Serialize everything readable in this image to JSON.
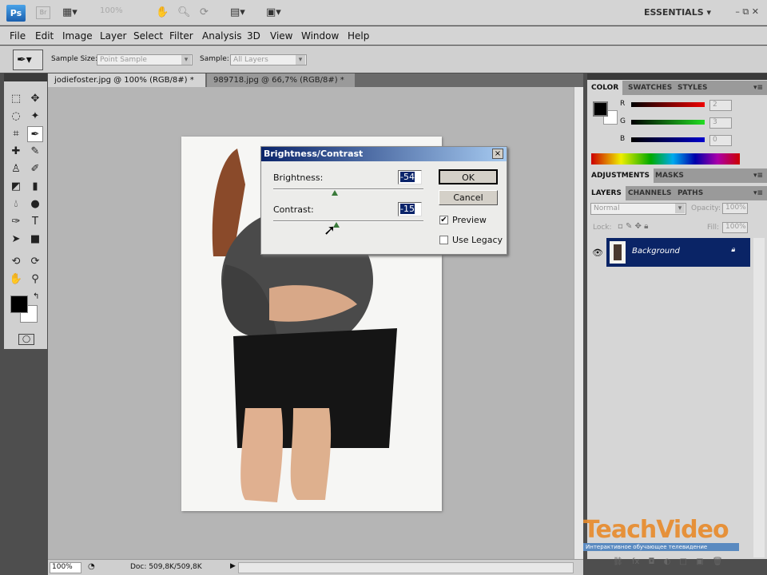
{
  "app": {
    "logo": "Ps",
    "bridge": "Br",
    "zoom": "100%",
    "workspace": "ESSENTIALS"
  },
  "menu": [
    "File",
    "Edit",
    "Image",
    "Layer",
    "Select",
    "Filter",
    "Analysis",
    "3D",
    "View",
    "Window",
    "Help"
  ],
  "options": {
    "sample_size_label": "Sample Size:",
    "sample_size_value": "Point Sample",
    "sample_label": "Sample:",
    "sample_value": "All Layers"
  },
  "tabs": [
    {
      "label": "jodiefoster.jpg @ 100% (RGB/8#) *"
    },
    {
      "label": "989718.jpg @ 66,7% (RGB/8#) *"
    }
  ],
  "tab_close": "×",
  "dialog": {
    "title": "Brightness/Contrast",
    "brightness_label": "Brightness:",
    "brightness_value": "-54",
    "contrast_label": "Contrast:",
    "contrast_value": "-15",
    "brightness_fraction": 0.41,
    "contrast_fraction": 0.42,
    "ok": "OK",
    "cancel": "Cancel",
    "preview_label": "Preview",
    "preview_checked": true,
    "legacy_label": "Use Legacy",
    "legacy_checked": false,
    "close": "×"
  },
  "color_panel": {
    "tabs": [
      "COLOR",
      "SWATCHES",
      "STYLES"
    ],
    "r_label": "R",
    "g_label": "G",
    "b_label": "B",
    "r": "2",
    "g": "3",
    "b": "0"
  },
  "adjustments_panel": {
    "tabs": [
      "ADJUSTMENTS",
      "MASKS"
    ]
  },
  "layers_panel": {
    "tabs": [
      "LAYERS",
      "CHANNELS",
      "PATHS"
    ],
    "blend_mode": "Normal",
    "opacity_label": "Opacity:",
    "opacity": "100%",
    "lock_label": "Lock:",
    "fill_label": "Fill:",
    "fill": "100%",
    "layer_name": "Background"
  },
  "status": {
    "zoom": "100%",
    "doc": "Doc: 509,8K/509,8K"
  },
  "watermark": {
    "brand": "TeachVideo",
    "tagline": "Интерактивное обучающее телевидение"
  },
  "colors": {
    "dialog_title": "#0a246a",
    "layer_selected": "#0a2466"
  }
}
